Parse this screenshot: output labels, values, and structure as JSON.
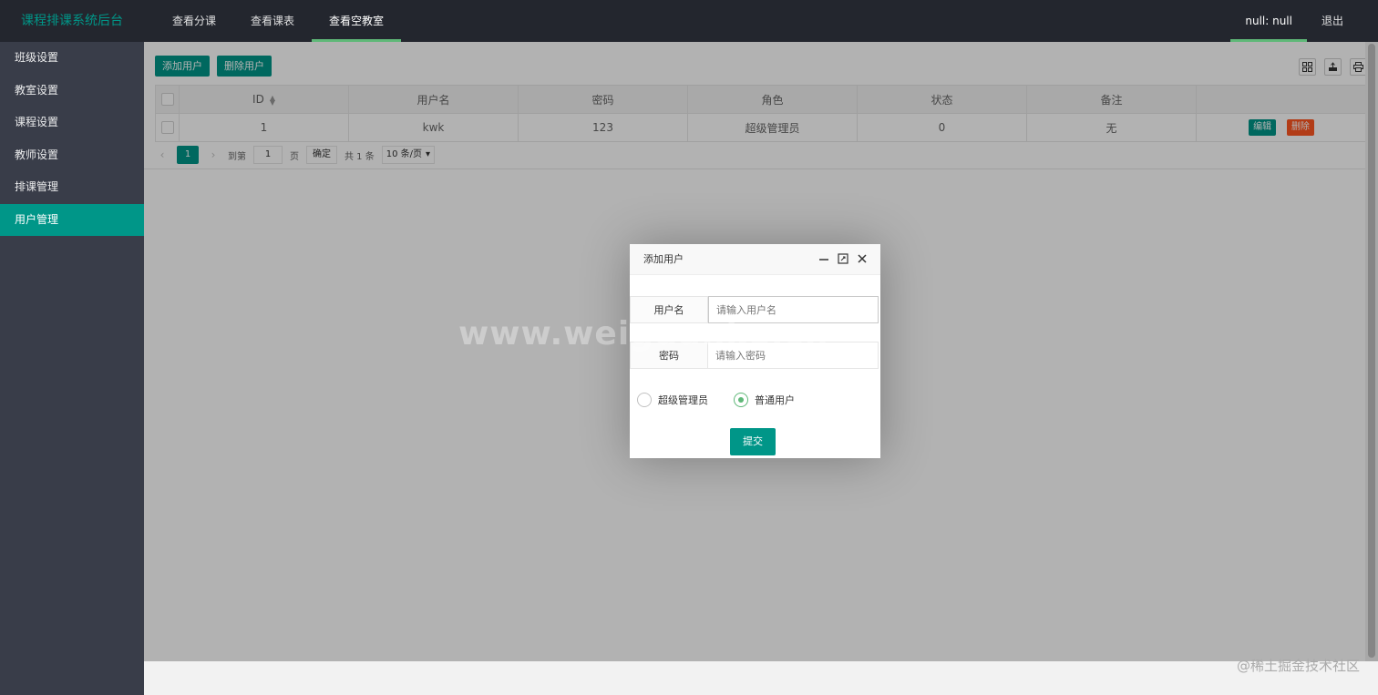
{
  "header": {
    "logo": "课程排课系统后台",
    "nav": [
      {
        "label": "查看分课"
      },
      {
        "label": "查看课表"
      },
      {
        "label": "查看空教室"
      }
    ],
    "user": "null: null",
    "logout": "退出"
  },
  "sidebar": {
    "items": [
      {
        "label": "班级设置"
      },
      {
        "label": "教室设置"
      },
      {
        "label": "课程设置"
      },
      {
        "label": "教师设置"
      },
      {
        "label": "排课管理"
      },
      {
        "label": "用户管理"
      }
    ],
    "active_index": 5
  },
  "toolbar": {
    "add_label": "添加用户",
    "delete_label": "删除用户",
    "icons": [
      "columns-icon",
      "export-icon",
      "print-icon"
    ]
  },
  "table": {
    "headers": [
      "ID",
      "用户名",
      "密码",
      "角色",
      "状态",
      "备注"
    ],
    "rows": [
      {
        "id": "1",
        "username": "kwk",
        "password": "123",
        "role": "超级管理员",
        "status": "0",
        "note": "无"
      }
    ],
    "row_actions": {
      "edit": "编辑",
      "delete": "删除"
    }
  },
  "pager": {
    "current": "1",
    "goto_label": "到第",
    "goto_value": "1",
    "page_label": "页",
    "confirm": "确定",
    "total": "共 1 条",
    "page_size": "10 条/页"
  },
  "dialog": {
    "title": "添加用户",
    "username_label": "用户名",
    "username_placeholder": "请输入用户名",
    "password_label": "密码",
    "password_placeholder": "请输入密码",
    "roles": [
      {
        "label": "超级管理员",
        "checked": false
      },
      {
        "label": "普通用户",
        "checked": true
      }
    ],
    "submit": "提交"
  },
  "watermark": "www.weiguanke.cn",
  "corner_mark": "@稀土掘金技术社区",
  "colors": {
    "accent": "#009688",
    "header_bg": "#23262e",
    "sidebar_bg": "#393d49",
    "danger": "#ff5722",
    "nav_underline": "#5fb878"
  }
}
